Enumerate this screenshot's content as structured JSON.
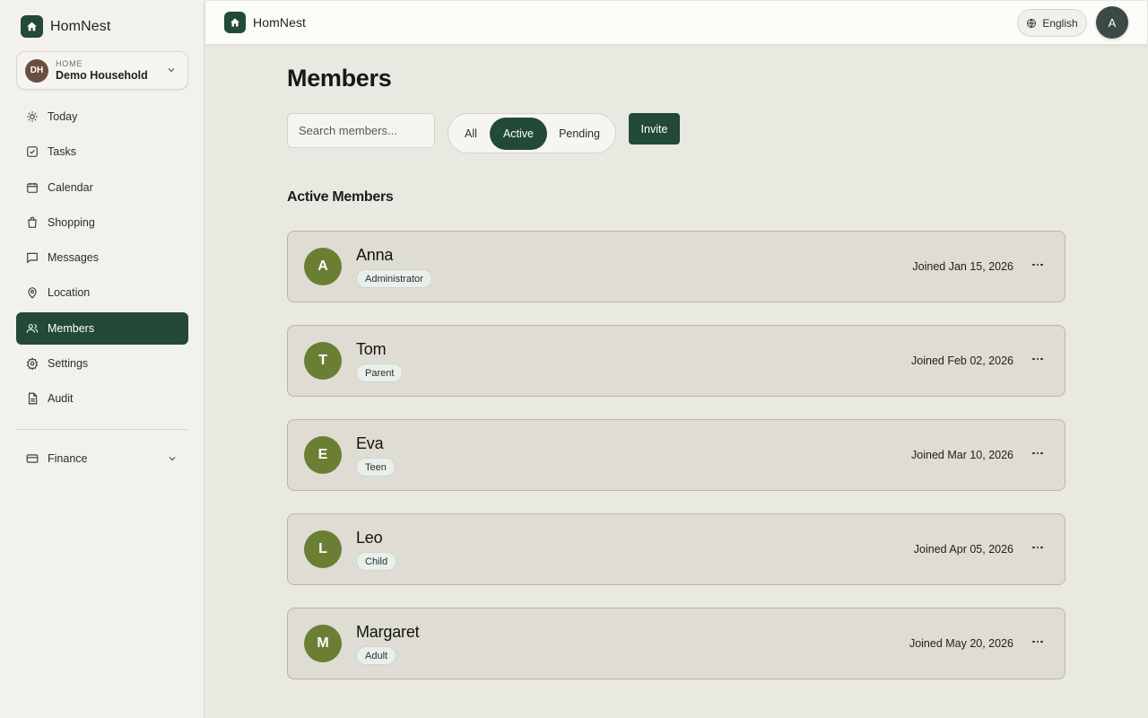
{
  "app": {
    "name": "HomNest"
  },
  "household": {
    "initials": "DH",
    "label": "HOME",
    "name": "Demo Household"
  },
  "sidebar": {
    "items": [
      {
        "label": "Today",
        "icon": "sun-icon"
      },
      {
        "label": "Tasks",
        "icon": "checkbox-icon"
      },
      {
        "label": "Calendar",
        "icon": "calendar-icon"
      },
      {
        "label": "Shopping",
        "icon": "shopping-bag-icon"
      },
      {
        "label": "Messages",
        "icon": "message-icon"
      },
      {
        "label": "Location",
        "icon": "map-pin-icon"
      },
      {
        "label": "Members",
        "icon": "users-icon",
        "active": true
      },
      {
        "label": "Settings",
        "icon": "gear-icon"
      },
      {
        "label": "Audit",
        "icon": "document-icon"
      }
    ],
    "finance": {
      "label": "Finance",
      "icon": "credit-card-icon"
    }
  },
  "topbar": {
    "brand": "HomNest",
    "language": "English",
    "user_initial": "A"
  },
  "main": {
    "title": "Members",
    "search_placeholder": "Search members...",
    "filters": {
      "all": "All",
      "active": "Active",
      "pending": "Pending",
      "selected": "Active"
    },
    "invite_label": "Invite",
    "section_title": "Active Members",
    "members": [
      {
        "initial": "A",
        "name": "Anna",
        "role": "Administrator",
        "joined": "Joined Jan 15, 2026"
      },
      {
        "initial": "T",
        "name": "Tom",
        "role": "Parent",
        "joined": "Joined Feb 02, 2026"
      },
      {
        "initial": "E",
        "name": "Eva",
        "role": "Teen",
        "joined": "Joined Mar 10, 2026"
      },
      {
        "initial": "L",
        "name": "Leo",
        "role": "Child",
        "joined": "Joined Apr 05, 2026"
      },
      {
        "initial": "M",
        "name": "Margaret",
        "role": "Adult",
        "joined": "Joined May 20, 2026"
      }
    ]
  },
  "colors": {
    "brand": "#234a38",
    "member_avatar": "#6a7f34",
    "household_avatar": "#6b4e3d"
  }
}
